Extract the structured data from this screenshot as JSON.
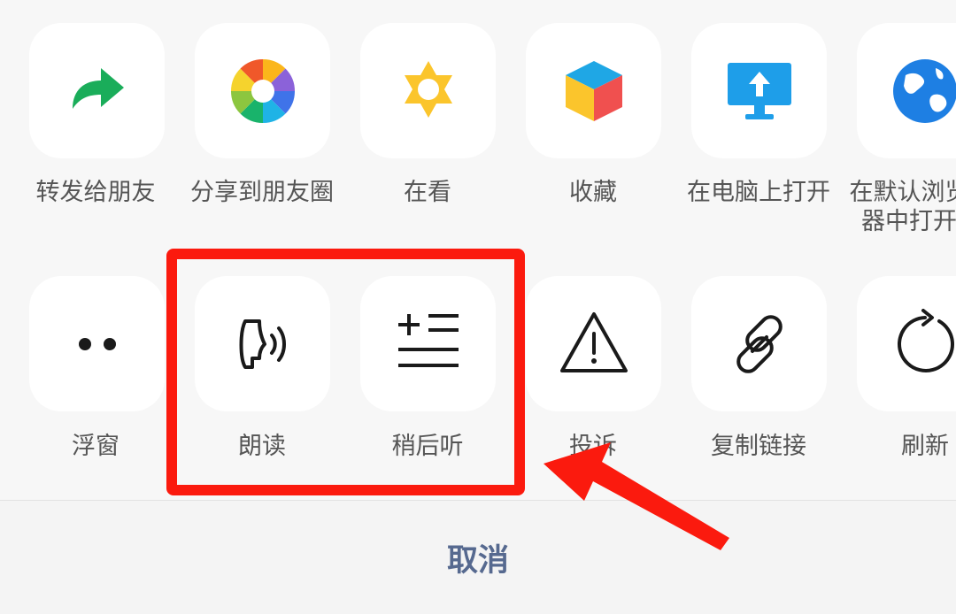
{
  "share_sheet": {
    "row1": [
      {
        "label": "转发给朋友",
        "icon": "forward-arrow-icon"
      },
      {
        "label": "分享到朋友圈",
        "icon": "moments-aperture-icon"
      },
      {
        "label": "在看",
        "icon": "wow-star-icon"
      },
      {
        "label": "收藏",
        "icon": "favorites-cube-icon"
      },
      {
        "label": "在电脑上打开",
        "icon": "open-on-computer-icon"
      },
      {
        "label": "在默认浏览器中打开",
        "icon": "browser-globe-icon"
      }
    ],
    "row2": [
      {
        "label": "浮窗",
        "icon": "float-window-icon"
      },
      {
        "label": "朗读",
        "icon": "read-aloud-icon"
      },
      {
        "label": "稍后听",
        "icon": "listen-later-icon"
      },
      {
        "label": "投诉",
        "icon": "complain-warning-icon"
      },
      {
        "label": "复制链接",
        "icon": "copy-link-icon"
      },
      {
        "label": "刷新",
        "icon": "refresh-icon"
      }
    ]
  },
  "cancel_label": "取消",
  "colors": {
    "highlight": "#fb1a0e",
    "cancel_text": "#56698f",
    "forward_green": "#1aad5a",
    "tile_background": "#ffffff",
    "sheet_background": "#f7f7f7"
  }
}
